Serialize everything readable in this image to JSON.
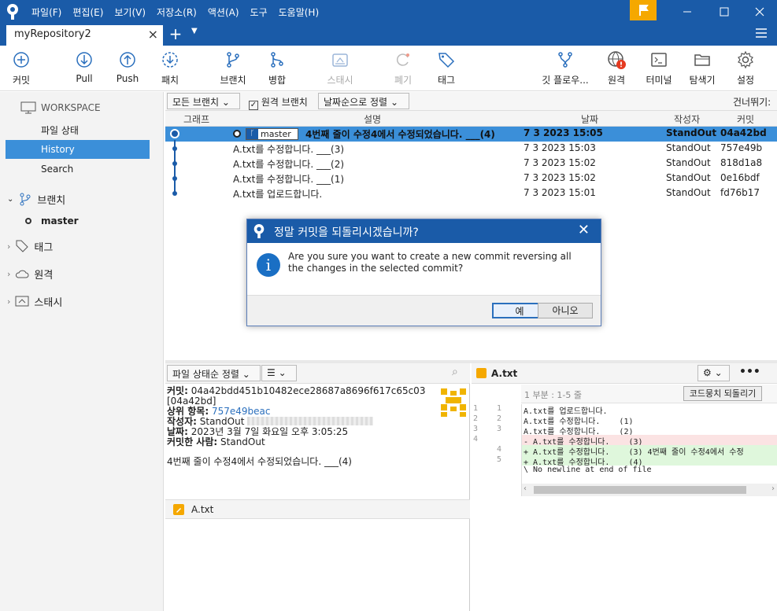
{
  "menu": [
    "파일(F)",
    "편집(E)",
    "보기(V)",
    "저장소(R)",
    "액션(A)",
    "도구",
    "도움말(H)"
  ],
  "tab": {
    "name": "myRepository2"
  },
  "toolbar": {
    "commit": "커밋",
    "pull": "Pull",
    "push": "Push",
    "patch": "패치",
    "branch": "브랜치",
    "merge": "병합",
    "stash": "스태시",
    "discard": "폐기",
    "tag": "태그",
    "gitflow": "깃 플로우...",
    "remote": "원격",
    "terminal": "터미널",
    "explorer": "탐색기",
    "settings": "설정"
  },
  "sidebar": {
    "workspace": "WORKSPACE",
    "items": [
      "파일 상태",
      "History",
      "Search"
    ],
    "branches": "브랜치",
    "branch_master": "master",
    "tags": "태그",
    "remotes": "원격",
    "stashes": "스태시"
  },
  "filters": {
    "branches": "모든 브랜치",
    "remote": "원격 브랜치",
    "sort": "날짜순으로 정렬",
    "jump": "건너뛰기:"
  },
  "columns": {
    "graph": "그래프",
    "desc": "설명",
    "date": "날짜",
    "author": "작성자",
    "commit": "커밋"
  },
  "commits": [
    {
      "branch": "master",
      "desc": "4번째 줄이 수정4에서 수정되었습니다. ___(4)",
      "date": "7 3 2023 15:05",
      "author": "StandOut",
      "hash": "04a42bd"
    },
    {
      "desc": "A.txt를 수정합니다. ___(3)",
      "date": "7 3 2023 15:03",
      "author": "StandOut",
      "hash": "757e49b"
    },
    {
      "desc": "A.txt를 수정합니다. ___(2)",
      "date": "7 3 2023 15:02",
      "author": "StandOut",
      "hash": "818d1a8"
    },
    {
      "desc": "A.txt를 수정합니다. ___(1)",
      "date": "7 3 2023 15:02",
      "author": "StandOut",
      "hash": "0e16bdf"
    },
    {
      "desc": "A.txt를 업로드합니다.",
      "date": "7 3 2023 15:01",
      "author": "StandOut",
      "hash": "fd76b17"
    }
  ],
  "details": {
    "sort": "파일 상태순 정렬",
    "commit_label": "커밋:",
    "commit_full": "04a42bdd451b10482ece28687a8696f617c65c03",
    "commit_short": "[04a42bd]",
    "parent_label": "상위 항목:",
    "parent": "757e49beac",
    "author_label": "작성자:",
    "author": "StandOut",
    "date_label": "날짜:",
    "date": "2023년 3월 7일 화요일 오후 3:05:25",
    "committer_label": "커밋한 사람:",
    "committer": "StandOut",
    "message": "4번째 줄이 수정4에서 수정되었습니다. ___(4)",
    "file": "A.txt"
  },
  "diff": {
    "file": "A.txt",
    "hunk": "1 부분 : 1-5 줄",
    "revert_hunk": "코드뭉치 되돌리기",
    "lines": [
      {
        "old": "1",
        "new": "1",
        "type": "ctx",
        "text": "  A.txt를 업로드합니다."
      },
      {
        "old": "2",
        "new": "2",
        "type": "ctx",
        "text": "  A.txt를 수정합니다. ___(1)"
      },
      {
        "old": "3",
        "new": "3",
        "type": "ctx",
        "text": "  A.txt를 수정합니다. ___(2)"
      },
      {
        "old": "4",
        "new": "",
        "type": "del",
        "text": "- A.txt를 수정합니다. ___(3)"
      },
      {
        "old": "",
        "new": "4",
        "type": "add",
        "text": "+ A.txt를 수정합니다. ___(3) 4번째 줄이 수정4에서 수정"
      },
      {
        "old": "",
        "new": "5",
        "type": "add",
        "text": "+ A.txt를 수정합니다. ___(4)"
      },
      {
        "old": "",
        "new": "",
        "type": "ctx",
        "text": "\\ No newline at end of file"
      }
    ]
  },
  "dialog": {
    "title": "정말 커밋을 되돌리시겠습니까?",
    "message": "Are you sure you want to create a new commit reversing all the changes in the selected commit?",
    "yes": "예",
    "no": "아니오"
  },
  "colors": {
    "brand": "#1a5ba8",
    "selection": "#3b8fd9",
    "flag": "#f5a800",
    "add_bg": "#dff7dc",
    "del_bg": "#fbe3e3"
  }
}
